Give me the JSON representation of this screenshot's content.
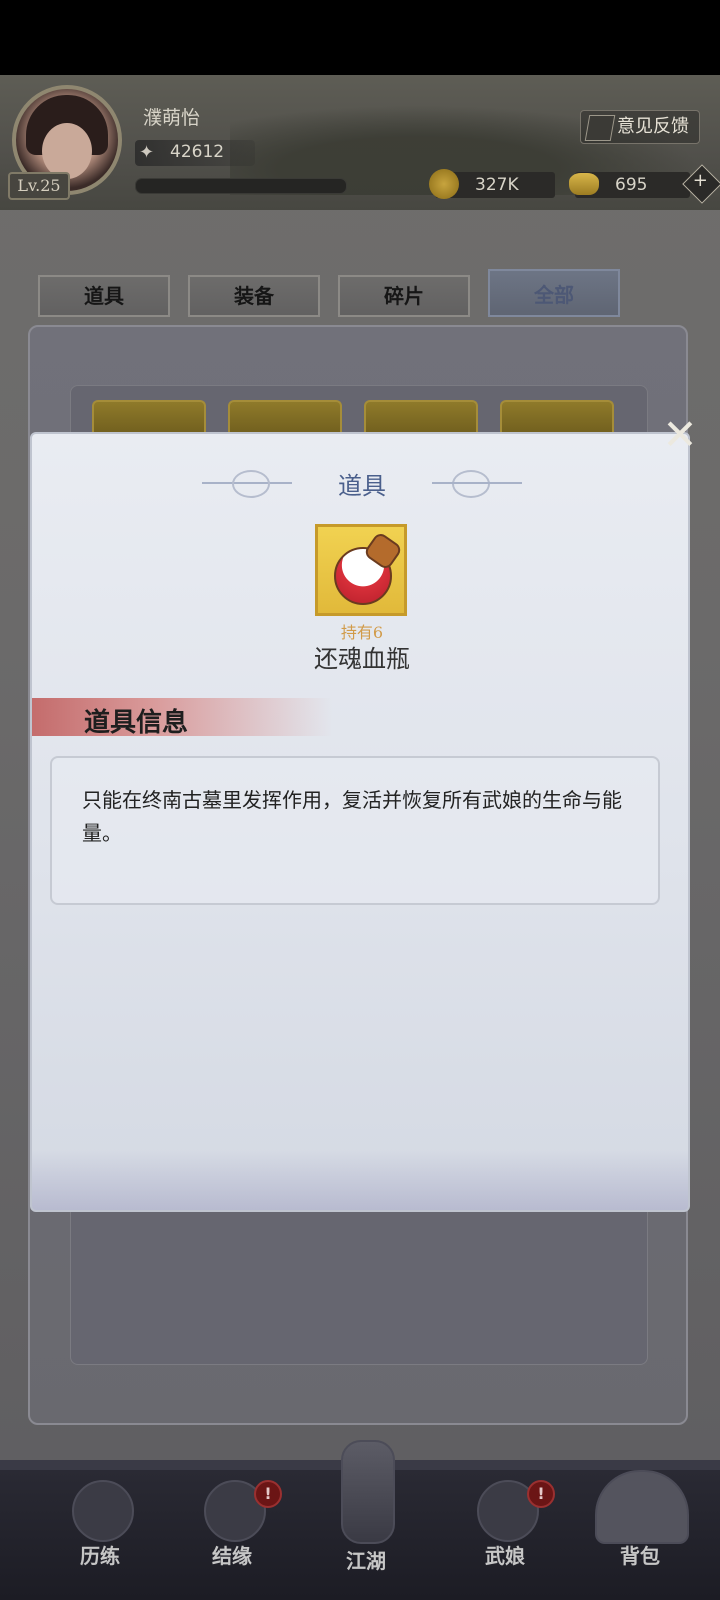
{
  "player": {
    "name": "濮萌怡",
    "level": "Lv.25",
    "power": "42612"
  },
  "header": {
    "feedback_label": "意见反馈",
    "coins": "327K",
    "ingots": "695",
    "add_label": "+"
  },
  "tabs": [
    {
      "label": "道具",
      "active": false
    },
    {
      "label": "装备",
      "active": false
    },
    {
      "label": "碎片",
      "active": false
    },
    {
      "label": "全部",
      "active": true
    }
  ],
  "modal": {
    "title": "道具",
    "item_icon": "blood-bottle-icon",
    "owned_label": "持有6",
    "item_name": "还魂血瓶",
    "section_title": "道具信息",
    "description": "只能在终南古墓里发挥作用，复活并恢复所有武娘的生命与能量。",
    "close_glyph": "✕"
  },
  "bottom_nav": [
    {
      "label": "历练",
      "icon": "cloud-icon",
      "badge": ""
    },
    {
      "label": "结缘",
      "icon": "card-icon",
      "badge": "!"
    },
    {
      "label": "江湖",
      "icon": "swords-icon",
      "badge": ""
    },
    {
      "label": "武娘",
      "icon": "hat-icon",
      "badge": "!"
    },
    {
      "label": "背包",
      "icon": "bag-fan-icon",
      "badge": ""
    }
  ],
  "colors": {
    "modal_title": "#4a5f8c",
    "owned_text": "#d19b49",
    "section_bar": "#c46c6c"
  }
}
